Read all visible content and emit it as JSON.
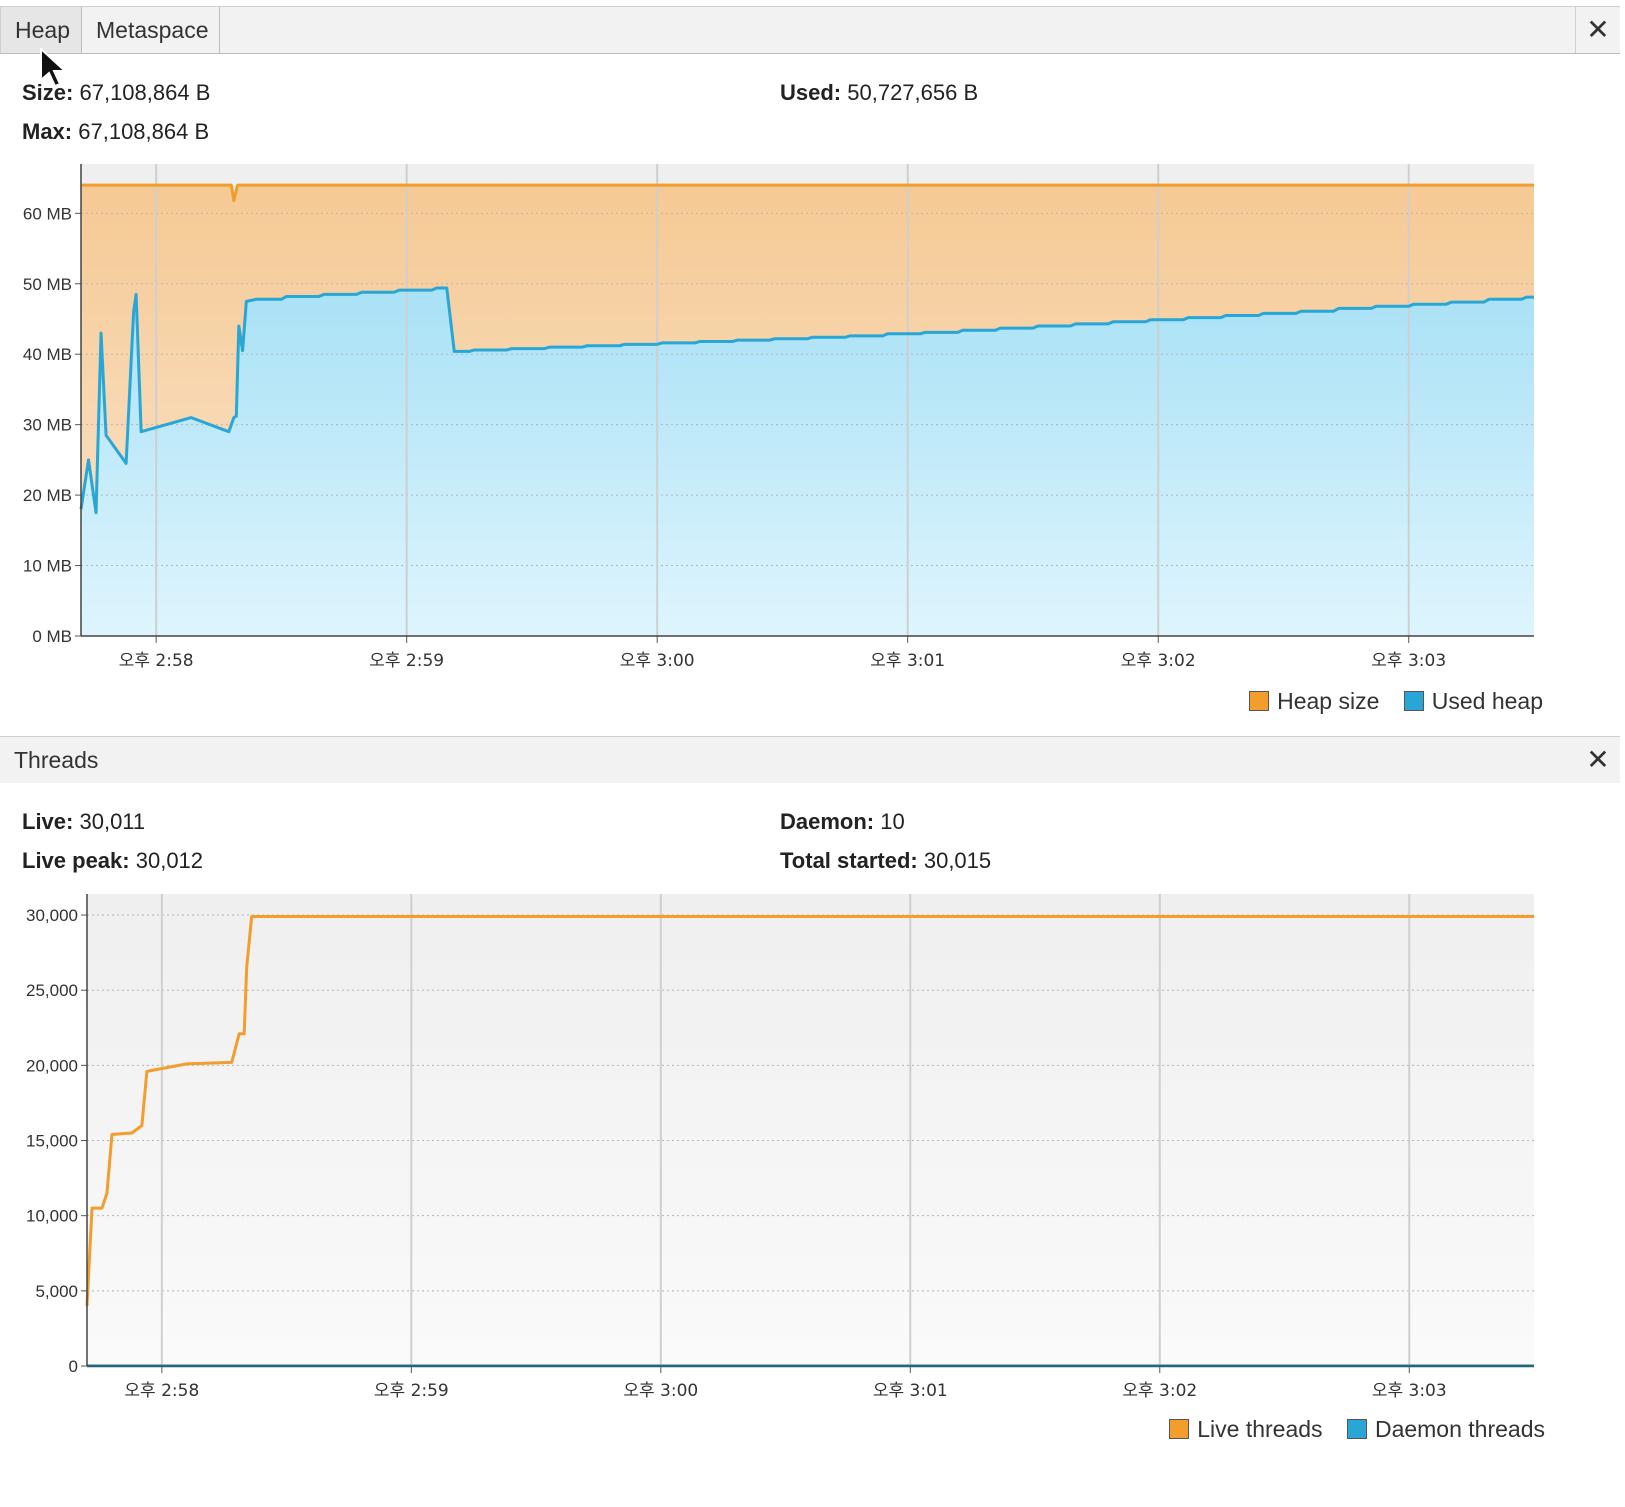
{
  "heap": {
    "tabs": [
      {
        "label": "Heap",
        "active": true
      },
      {
        "label": "Metaspace",
        "active": false
      }
    ],
    "close_icon": "close-icon",
    "stats": {
      "size_label": "Size:",
      "size_value": "67,108,864 B",
      "used_label": "Used:",
      "used_value": "50,727,656 B",
      "max_label": "Max:",
      "max_value": "67,108,864 B"
    },
    "legend": [
      {
        "label": "Heap size",
        "color": "#f29d2c"
      },
      {
        "label": "Used heap",
        "color": "#29a6d6"
      }
    ]
  },
  "threads": {
    "title": "Threads",
    "close_icon": "close-icon",
    "stats": {
      "live_label": "Live:",
      "live_value": "30,011",
      "daemon_label": "Daemon:",
      "daemon_value": "10",
      "peak_label": "Live peak:",
      "peak_value": "30,012",
      "total_label": "Total started:",
      "total_value": "30,015"
    },
    "legend": [
      {
        "label": "Live threads",
        "color": "#f29d2c"
      },
      {
        "label": "Daemon threads",
        "color": "#29a6d6"
      }
    ]
  },
  "chart_data": [
    {
      "type": "area",
      "ylim": [
        0,
        67
      ],
      "y_ticks": [
        0,
        10,
        20,
        30,
        40,
        50,
        60
      ],
      "y_tick_labels": [
        "0 MB",
        "10 MB",
        "20 MB",
        "30 MB",
        "40 MB",
        "50 MB",
        "60 MB"
      ],
      "xlim": [
        -0.3,
        5.5
      ],
      "x_ticks": [
        0,
        1,
        2,
        3,
        4,
        5
      ],
      "x_tick_labels": [
        "오후 2:58",
        "오후 2:59",
        "오후 3:00",
        "오후 3:01",
        "오후 3:02",
        "오후 3:03"
      ],
      "grid": true,
      "legend_position": "bottom-right",
      "series": [
        {
          "name": "Heap size",
          "color": "#f29d2c",
          "points": [
            [
              -0.3,
              64
            ],
            [
              0.3,
              64
            ],
            [
              0.31,
              61.8
            ],
            [
              0.325,
              64
            ],
            [
              5.5,
              64
            ]
          ]
        },
        {
          "name": "Used heap",
          "color": "#29a6d6",
          "points": [
            [
              -0.3,
              18
            ],
            [
              -0.27,
              25
            ],
            [
              -0.24,
              17.5
            ],
            [
              -0.22,
              43
            ],
            [
              -0.2,
              28.5
            ],
            [
              -0.12,
              24.5
            ],
            [
              -0.09,
              46
            ],
            [
              -0.08,
              48.5
            ],
            [
              -0.06,
              29
            ],
            [
              0.14,
              31
            ],
            [
              0.29,
              29
            ],
            [
              0.31,
              31
            ],
            [
              0.32,
              31.2
            ],
            [
              0.33,
              44
            ],
            [
              0.345,
              40.5
            ],
            [
              0.36,
              47.5
            ],
            [
              0.4,
              47.8
            ],
            [
              0.5,
              47.8
            ],
            [
              0.52,
              48.2
            ],
            [
              0.65,
              48.2
            ],
            [
              0.67,
              48.5
            ],
            [
              0.8,
              48.5
            ],
            [
              0.82,
              48.8
            ],
            [
              0.95,
              48.8
            ],
            [
              0.97,
              49.1
            ],
            [
              1.1,
              49.1
            ],
            [
              1.12,
              49.4
            ],
            [
              1.16,
              49.4
            ],
            [
              1.19,
              40.4
            ],
            [
              1.25,
              40.4
            ],
            [
              1.27,
              40.6
            ],
            [
              1.4,
              40.6
            ],
            [
              1.42,
              40.8
            ],
            [
              1.55,
              40.8
            ],
            [
              1.57,
              41
            ],
            [
              1.7,
              41
            ],
            [
              1.72,
              41.2
            ],
            [
              1.85,
              41.2
            ],
            [
              1.87,
              41.4
            ],
            [
              2,
              41.4
            ],
            [
              2.02,
              41.6
            ],
            [
              2.15,
              41.6
            ],
            [
              2.17,
              41.8
            ],
            [
              2.3,
              41.8
            ],
            [
              2.32,
              42
            ],
            [
              2.45,
              42
            ],
            [
              2.47,
              42.2
            ],
            [
              2.6,
              42.2
            ],
            [
              2.62,
              42.4
            ],
            [
              2.75,
              42.4
            ],
            [
              2.77,
              42.6
            ],
            [
              2.9,
              42.6
            ],
            [
              2.92,
              42.9
            ],
            [
              3.05,
              42.9
            ],
            [
              3.07,
              43.1
            ],
            [
              3.2,
              43.1
            ],
            [
              3.22,
              43.4
            ],
            [
              3.35,
              43.4
            ],
            [
              3.37,
              43.7
            ],
            [
              3.5,
              43.7
            ],
            [
              3.52,
              44
            ],
            [
              3.65,
              44
            ],
            [
              3.67,
              44.3
            ],
            [
              3.8,
              44.3
            ],
            [
              3.82,
              44.6
            ],
            [
              3.95,
              44.6
            ],
            [
              3.97,
              44.9
            ],
            [
              4.1,
              44.9
            ],
            [
              4.12,
              45.2
            ],
            [
              4.25,
              45.2
            ],
            [
              4.27,
              45.5
            ],
            [
              4.4,
              45.5
            ],
            [
              4.42,
              45.8
            ],
            [
              4.55,
              45.8
            ],
            [
              4.57,
              46.1
            ],
            [
              4.7,
              46.1
            ],
            [
              4.72,
              46.5
            ],
            [
              4.85,
              46.5
            ],
            [
              4.87,
              46.8
            ],
            [
              5,
              46.8
            ],
            [
              5.02,
              47.1
            ],
            [
              5.15,
              47.1
            ],
            [
              5.17,
              47.4
            ],
            [
              5.3,
              47.4
            ],
            [
              5.32,
              47.8
            ],
            [
              5.45,
              47.8
            ],
            [
              5.47,
              48.1
            ],
            [
              5.5,
              48.1
            ]
          ]
        }
      ]
    },
    {
      "type": "line",
      "ylim": [
        0,
        31400
      ],
      "y_ticks": [
        0,
        5000,
        10000,
        15000,
        20000,
        25000,
        30000
      ],
      "y_tick_labels": [
        "0",
        "5,000",
        "10,000",
        "15,000",
        "20,000",
        "25,000",
        "30,000"
      ],
      "xlim": [
        -0.3,
        5.5
      ],
      "x_ticks": [
        0,
        1,
        2,
        3,
        4,
        5
      ],
      "x_tick_labels": [
        "오후 2:58",
        "오후 2:59",
        "오후 3:00",
        "오후 3:01",
        "오후 3:02",
        "오후 3:03"
      ],
      "grid": true,
      "legend_position": "bottom-right",
      "series": [
        {
          "name": "Live threads",
          "color": "#f29d2c",
          "points": [
            [
              -0.3,
              4000
            ],
            [
              -0.28,
              10500
            ],
            [
              -0.24,
              10500
            ],
            [
              -0.22,
              11500
            ],
            [
              -0.2,
              15400
            ],
            [
              -0.12,
              15500
            ],
            [
              -0.08,
              16000
            ],
            [
              -0.06,
              19600
            ],
            [
              0.1,
              20100
            ],
            [
              0.28,
              20200
            ],
            [
              0.31,
              22100
            ],
            [
              0.33,
              22100
            ],
            [
              0.34,
              26500
            ],
            [
              0.36,
              29900
            ],
            [
              5.5,
              29900
            ]
          ]
        },
        {
          "name": "Daemon threads",
          "color": "#29a6d6",
          "points": [
            [
              -0.3,
              10
            ],
            [
              5.5,
              10
            ]
          ]
        }
      ]
    }
  ]
}
